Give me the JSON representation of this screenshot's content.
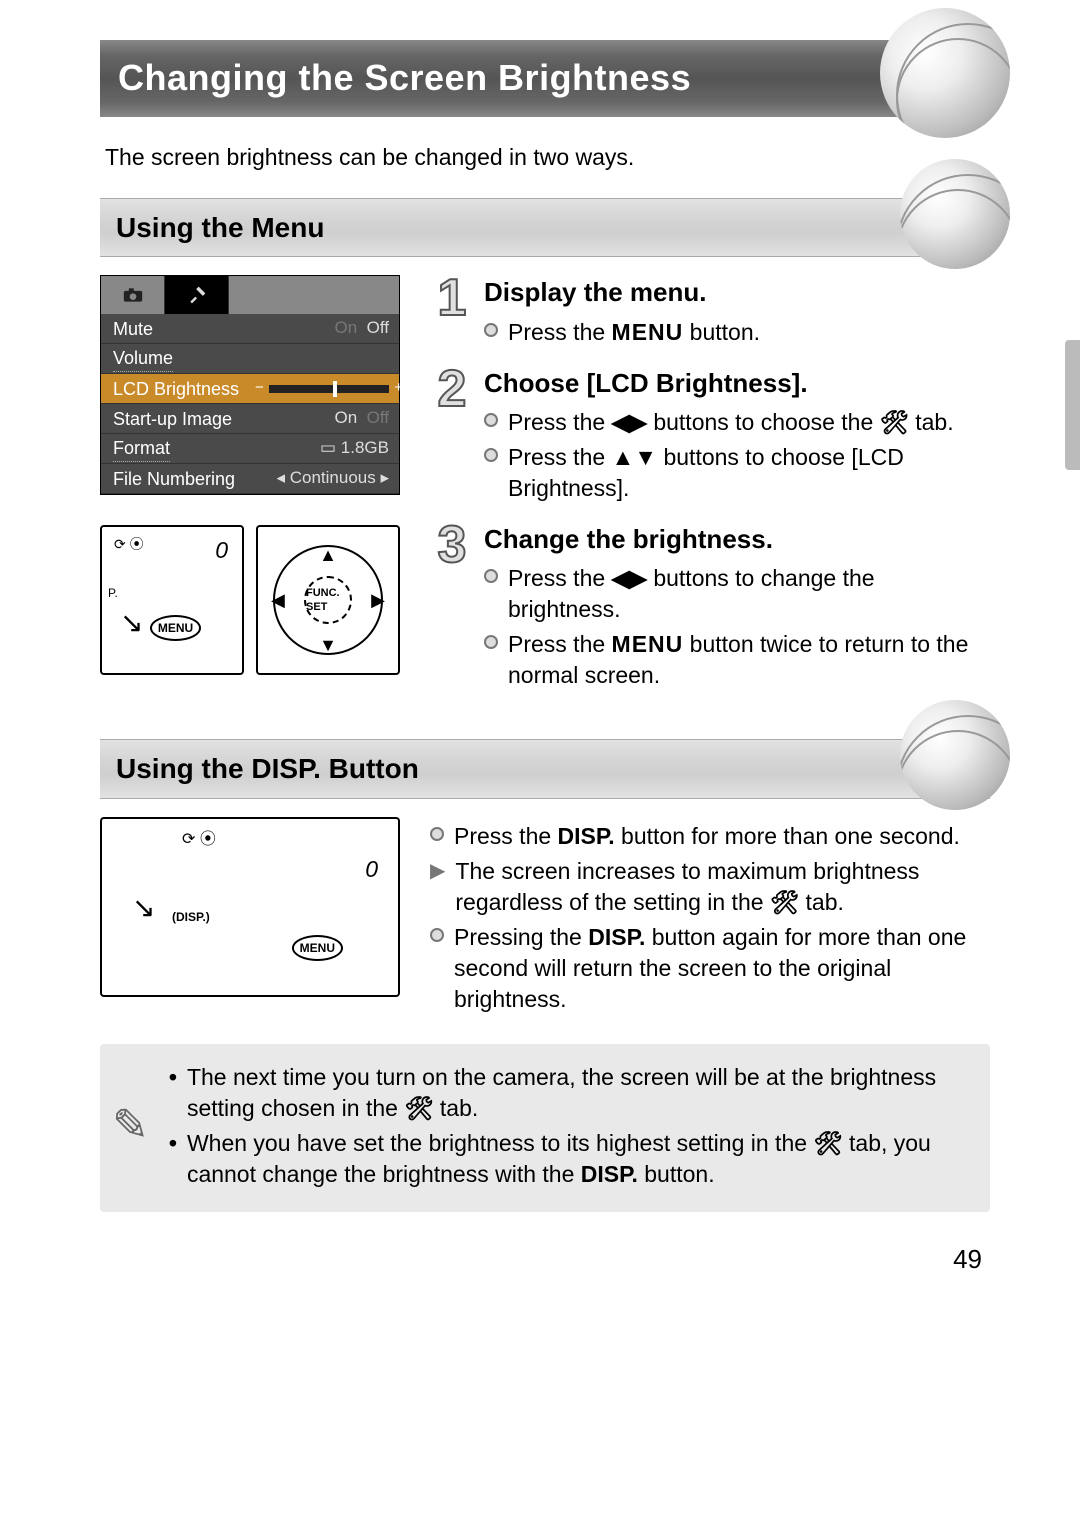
{
  "page_number": "49",
  "title": "Changing the Screen Brightness",
  "intro": "The screen brightness can be changed in two ways.",
  "section_menu": {
    "heading": "Using the Menu",
    "screenshot": {
      "rows": [
        {
          "label": "Mute",
          "value_on": "On",
          "value_off": "Off"
        },
        {
          "label": "Volume",
          "value": ""
        },
        {
          "label": "LCD Brightness",
          "is_slider": true
        },
        {
          "label": "Start-up Image",
          "value_on": "On",
          "value_off": "Off"
        },
        {
          "label": "Format",
          "value": "1.8GB"
        },
        {
          "label": "File Numbering",
          "value": "Continuous"
        }
      ]
    },
    "diagram_labels": {
      "menu": "MENU",
      "func": "FUNC.\nSET",
      "zero": "0"
    },
    "steps": [
      {
        "num": "1",
        "title": "Display the menu.",
        "bullets": [
          {
            "t1": "Press the ",
            "icon": "MENU",
            "t2": " button."
          }
        ]
      },
      {
        "num": "2",
        "title": "Choose [LCD Brightness].",
        "bullets": [
          {
            "t1": "Press the ",
            "icon": "LR",
            "t2": " buttons to choose the ",
            "icon2": "TOOLS",
            "t3": " tab."
          },
          {
            "t1": "Press the ",
            "icon": "UD",
            "t2": " buttons to choose [LCD Brightness]."
          }
        ]
      },
      {
        "num": "3",
        "title": "Change the brightness.",
        "bullets": [
          {
            "t1": "Press the ",
            "icon": "LR",
            "t2": " buttons to change the brightness."
          },
          {
            "t1": "Press the ",
            "icon": "MENU",
            "t2": " button twice to return to the normal screen."
          }
        ]
      }
    ]
  },
  "section_disp": {
    "heading_a": "Using the ",
    "heading_b": " Button",
    "disp_word": "DISP.",
    "diagram_labels": {
      "disp": "DISP.",
      "menu": "MENU",
      "zero": "0"
    },
    "bullets": [
      {
        "kind": "dot",
        "t1": "Press the ",
        "icon": "DISP",
        "t2": " button for more than one second."
      },
      {
        "kind": "arrow",
        "t1": "The screen increases to maximum brightness regardless of the setting in the ",
        "icon": "TOOLS",
        "t2": " tab."
      },
      {
        "kind": "dot",
        "t1": "Pressing the ",
        "icon": "DISP",
        "t2": " button again for more than one second will return the screen to the original brightness."
      }
    ]
  },
  "note": {
    "items": [
      {
        "t1": "The next time you turn on the camera, the screen will be at the brightness setting chosen in the ",
        "icon": "TOOLS",
        "t2": " tab."
      },
      {
        "t1": "When you have set the brightness to its highest setting in the ",
        "icon": "TOOLS",
        "t2": " tab, you cannot change the brightness with the ",
        "icon2": "DISP",
        "t3": " button."
      }
    ]
  }
}
